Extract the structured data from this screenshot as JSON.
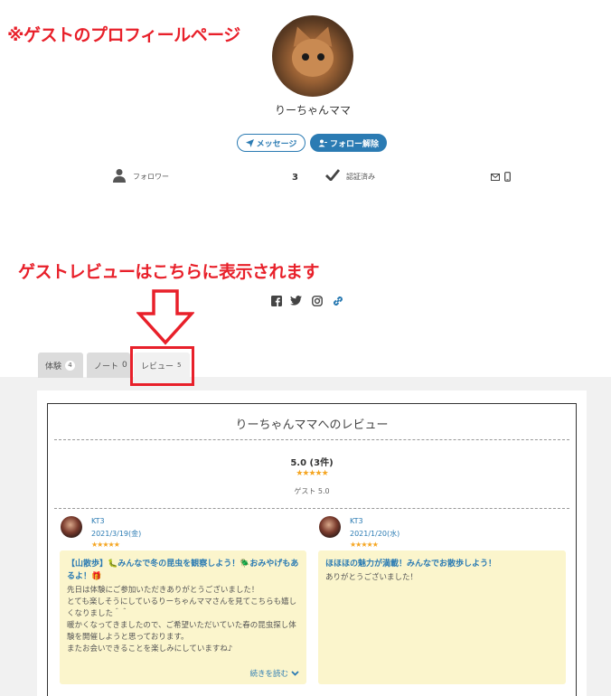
{
  "annotations": {
    "top": "※ゲストのプロフィールページ",
    "middle": "ゲストレビューはこちらに表示されます"
  },
  "profile": {
    "name": "りーちゃんママ",
    "buttons": {
      "message": "メッセージ",
      "unfollow": "フォロー解除"
    },
    "stats": {
      "follower_label": "フォロワー",
      "follower_count": "3",
      "verified_label": "認証済み"
    }
  },
  "tabs": [
    {
      "label": "体験",
      "count": "4"
    },
    {
      "label": "ノート",
      "count": "0"
    },
    {
      "label": "レビュー",
      "count": "5"
    }
  ],
  "reviews": {
    "title": "りーちゃんママへのレビュー",
    "average": "5.0 (3件)",
    "average_stars": "★★★★★",
    "guest_score": "ゲスト 5.0",
    "items": [
      {
        "name": "KT3",
        "date": "2021/3/19(金)",
        "stars": "★★★★★",
        "title": "【山散歩】🐛みんなで冬の昆虫を観察しよう！🪲おみやげもあるよ！🎁",
        "body": "先日は体験にご参加いただきありがとうございました！\nとても楽しそうにしているりーちゃんママさんを見てこちらも嬉しくなりました＾＾\n暖かくなってきましたので、ご希望いただいていた春の昆虫探し体験を開催しようと思っております。\nまたお会いできることを楽しみにしていますね♪",
        "read_more": "続きを読む"
      },
      {
        "name": "KT3",
        "date": "2021/1/20(水)",
        "stars": "★★★★★",
        "title": "ほほほの魅力が満載！みんなでお散歩しよう！",
        "body": "ありがとうございました！"
      }
    ]
  },
  "colors": {
    "accent": "#2b7bb3",
    "annotation": "#e8202a",
    "star": "#f5a623",
    "card_bg": "#fbf5cc"
  }
}
